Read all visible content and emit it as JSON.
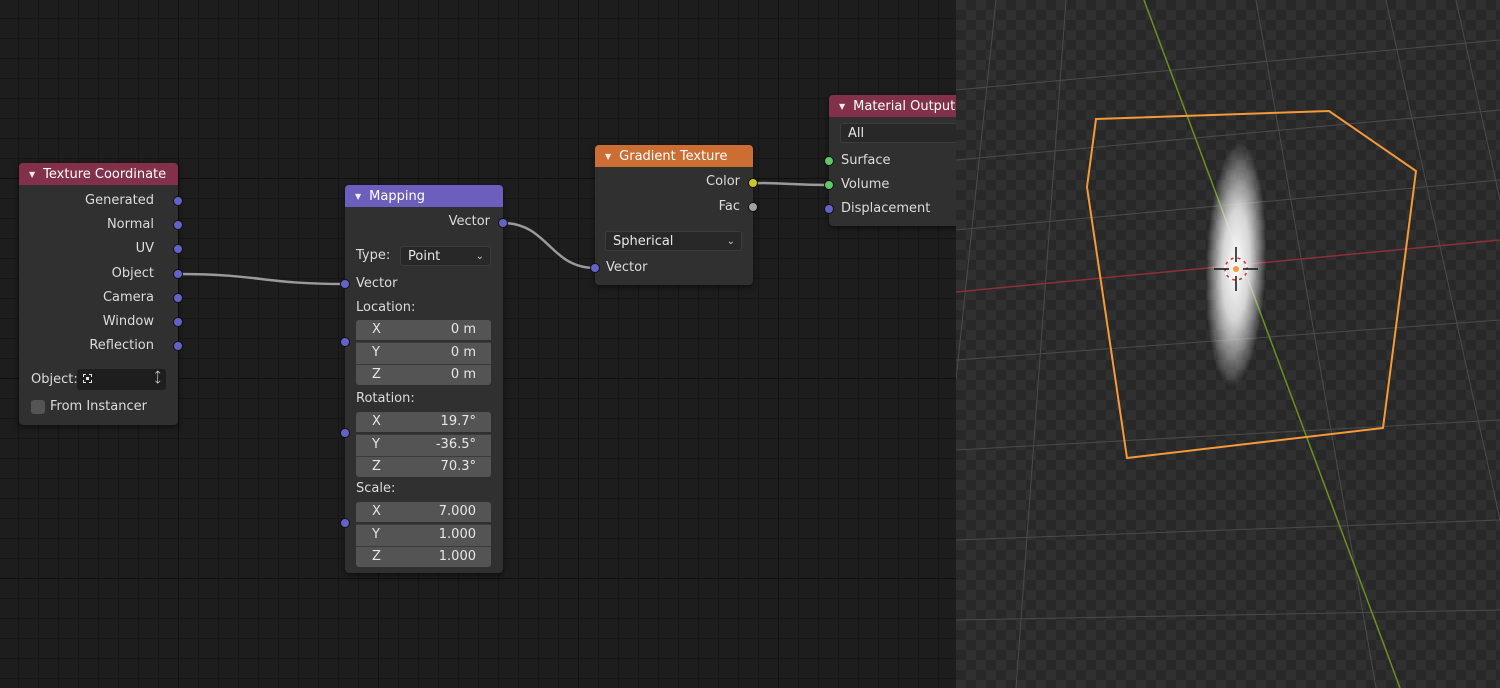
{
  "node_editor": {
    "texture_coordinate": {
      "title": "Texture Coordinate",
      "outputs": [
        "Generated",
        "Normal",
        "UV",
        "Object",
        "Camera",
        "Window",
        "Reflection"
      ],
      "object_label": "Object:",
      "from_instancer_label": "From Instancer"
    },
    "mapping": {
      "title": "Mapping",
      "output_vector": "Vector",
      "type_label": "Type:",
      "type_value": "Point",
      "input_vector": "Vector",
      "location_label": "Location:",
      "location": [
        {
          "axis": "X",
          "value": "0 m"
        },
        {
          "axis": "Y",
          "value": "0 m"
        },
        {
          "axis": "Z",
          "value": "0 m"
        }
      ],
      "rotation_label": "Rotation:",
      "rotation": [
        {
          "axis": "X",
          "value": "19.7°"
        },
        {
          "axis": "Y",
          "value": "-36.5°"
        },
        {
          "axis": "Z",
          "value": "70.3°"
        }
      ],
      "scale_label": "Scale:",
      "scale": [
        {
          "axis": "X",
          "value": "7.000"
        },
        {
          "axis": "Y",
          "value": "1.000"
        },
        {
          "axis": "Z",
          "value": "1.000"
        }
      ]
    },
    "gradient_texture": {
      "title": "Gradient Texture",
      "out_color": "Color",
      "out_fac": "Fac",
      "gradient_type": "Spherical",
      "in_vector": "Vector"
    },
    "material_output": {
      "title": "Material Output",
      "target": "All",
      "inputs": [
        "Surface",
        "Volume",
        "Displacement"
      ]
    }
  },
  "colors": {
    "input_header": "#83314a",
    "vector_header": "#6c5ebd",
    "texture_header": "#cc6d34",
    "selection_outline": "#f5993a",
    "x_axis": "#8b2f3a",
    "y_axis": "#6b8f23"
  }
}
